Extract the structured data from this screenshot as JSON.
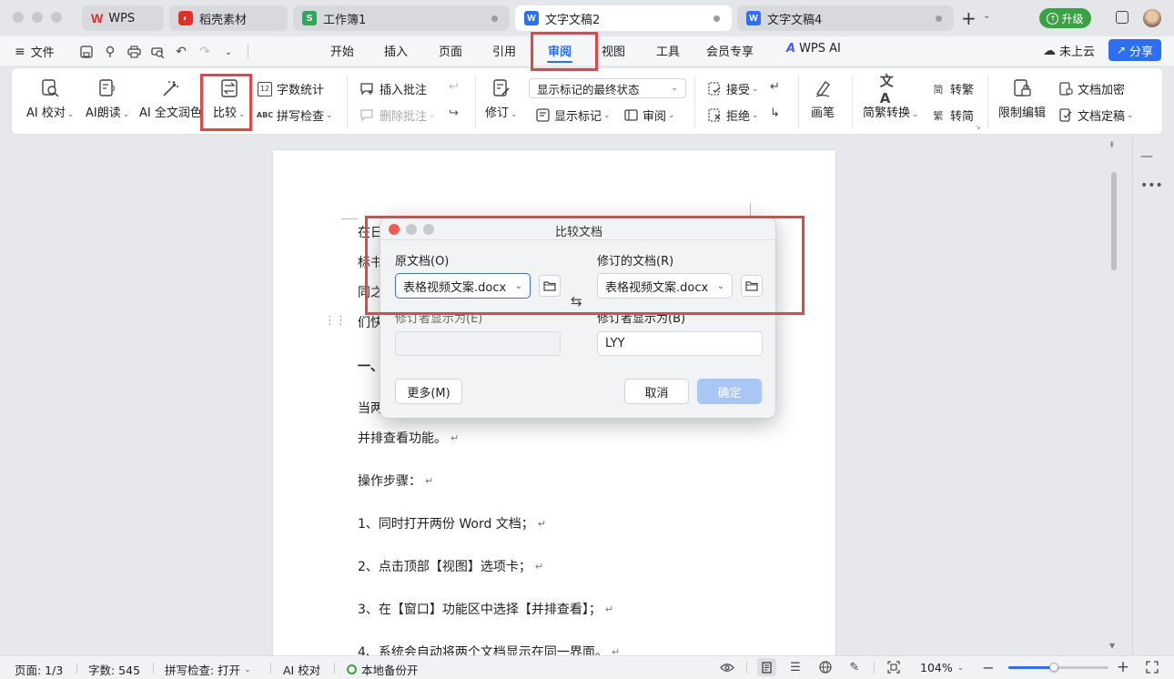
{
  "titlebar": {
    "tabs": [
      {
        "label": "WPS",
        "icon": "wps-logo-icon",
        "color": "#e0302a"
      },
      {
        "label": "稻壳素材",
        "icon": "docer-icon",
        "color": "#e0302a"
      },
      {
        "label": "工作簿1",
        "icon": "spreadsheet-icon",
        "color": "#2fa65a"
      },
      {
        "label": "文字文稿2",
        "icon": "writer-icon",
        "color": "#2e6ff2"
      },
      {
        "label": "文字文稿4",
        "icon": "writer-icon",
        "color": "#2e6ff2"
      }
    ],
    "upgrade_label": "升级",
    "upgrade_color": "#3aa144"
  },
  "menubar": {
    "file_label": "文件",
    "tabs": [
      "开始",
      "插入",
      "页面",
      "引用",
      "审阅",
      "视图",
      "工具",
      "会员专享",
      "WPS AI"
    ],
    "active_tab": "审阅",
    "cloud_label": "未上云",
    "share_label": "分享",
    "accent_color": "#2e6ff2"
  },
  "ribbon": {
    "ai_proofread": "AI 校对",
    "ai_read": "AI朗读",
    "ai_polish": "AI 全文润色",
    "compare": "比较",
    "word_count": "字数统计",
    "spell_check": "拼写检查",
    "insert_comment": "插入批注",
    "delete_comment": "删除批注",
    "revise": "修订",
    "markup_state": "显示标记的最终状态",
    "show_markup": "显示标记",
    "review": "审阅",
    "accept": "接受",
    "reject": "拒绝",
    "pen": "画笔",
    "trad_simp": "简繁转换",
    "to_trad": "转繁",
    "to_simp": "转简",
    "restrict_edit": "限制编辑",
    "doc_encrypt": "文档加密",
    "doc_finalize": "文档定稿"
  },
  "document": {
    "lines": [
      "在日",
      "标书",
      "同之",
      "们快",
      "一、",
      "当两",
      "并排查看功能。",
      "操作步骤：",
      "1、同时打开两份 Word 文档；",
      "2、点击顶部【视图】选项卡；",
      "3、在【窗口】功能区中选择【并排查看】；",
      "4、系统会自动将两个文档显示在同一界面。"
    ]
  },
  "dialog": {
    "title": "比较文档",
    "original_label": "原文档(O)",
    "original_value": "表格视频文案.docx",
    "revised_label": "修订的文档(R)",
    "revised_value": "表格视频文案.docx",
    "original_reviewer_label": "修订者显示为(E)",
    "original_reviewer_value": "",
    "revised_reviewer_label": "修订者显示为(B)",
    "revised_reviewer_value": "LYY",
    "more_label": "更多(M)",
    "cancel_label": "取消",
    "ok_label": "确定"
  },
  "statusbar": {
    "page": "页面: 1/3",
    "words": "字数: 545",
    "spell": "拼写检查: 打开",
    "ai_check": "AI 校对",
    "backup": "本地备份开",
    "zoom": "104%",
    "zoom_level": 0.45
  }
}
